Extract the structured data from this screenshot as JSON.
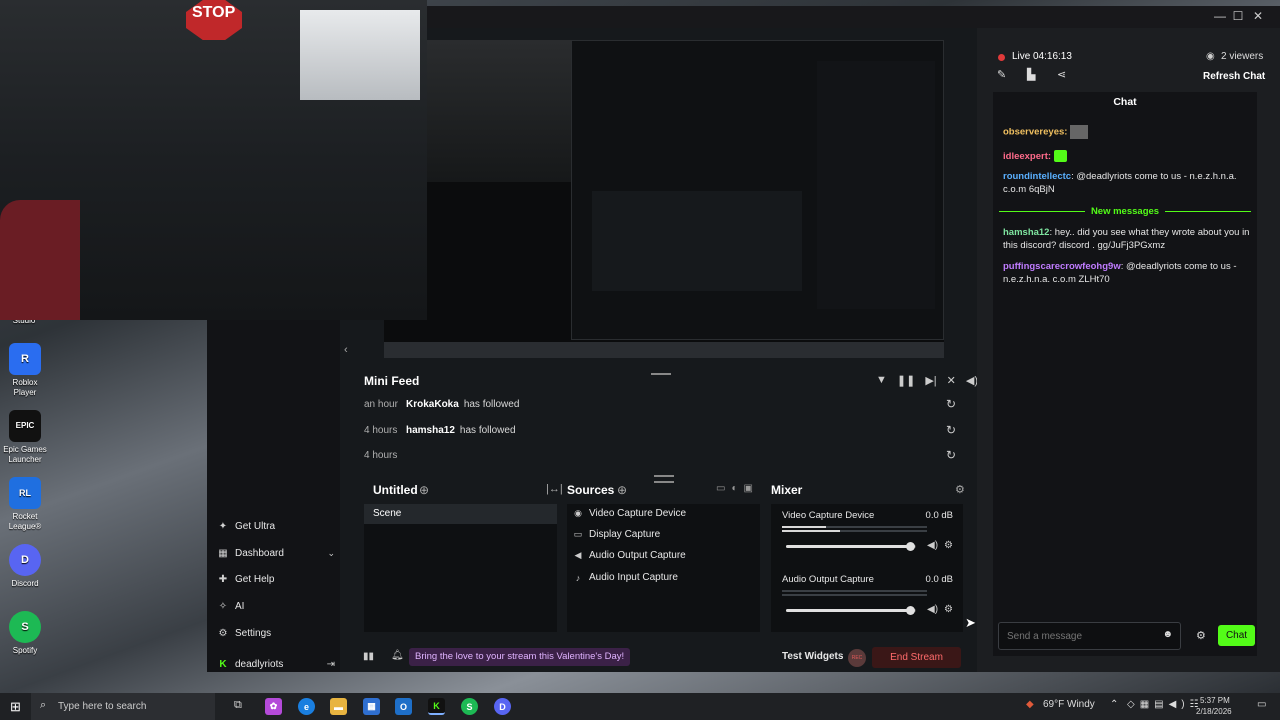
{
  "desktop": {
    "icons": [
      {
        "label": "Studio",
        "color": "#3a3f45",
        "glyph": ""
      },
      {
        "label": "Roblox Player",
        "color": "#2a6df0",
        "glyph": "R"
      },
      {
        "label": "Epic Games Launcher",
        "color": "#111111",
        "glyph": "EPIC"
      },
      {
        "label": "Rocket League®",
        "color": "#1f6fe0",
        "glyph": "RL"
      },
      {
        "label": "Discord",
        "color": "#5865f2",
        "glyph": "D"
      },
      {
        "label": "Spotify",
        "color": "#1db954",
        "glyph": "S"
      }
    ]
  },
  "webcam": {
    "sign": "STOP"
  },
  "app": {
    "window_controls": [
      "—",
      "☐",
      "✕"
    ],
    "nav": {
      "items": [
        {
          "label": "Get Ultra",
          "icon": "sparkle-icon"
        },
        {
          "label": "Dashboard",
          "icon": "dashboard-icon",
          "has_chevron": true
        },
        {
          "label": "Get Help",
          "icon": "help-icon"
        },
        {
          "label": "AI",
          "icon": "ai-icon"
        },
        {
          "label": "Settings",
          "icon": "gear-icon"
        }
      ],
      "user": "deadlyriots"
    },
    "mini_feed": {
      "title": "Mini Feed",
      "rows": [
        {
          "time": "an hour",
          "name": "KrokaKoka",
          "action": "has followed"
        },
        {
          "time": "4 hours",
          "name": "hamsha12",
          "action": "has followed"
        },
        {
          "time": "4 hours",
          "name": "",
          "action": ""
        }
      ]
    },
    "scenes": {
      "title": "Untitled",
      "items": [
        "Scene"
      ]
    },
    "sources": {
      "title": "Sources",
      "items": [
        {
          "label": "Video Capture Device",
          "icon": "webcam-icon"
        },
        {
          "label": "Display Capture",
          "icon": "monitor-icon"
        },
        {
          "label": "Audio Output Capture",
          "icon": "speaker-icon"
        },
        {
          "label": "Audio Input Capture",
          "icon": "mic-icon"
        }
      ]
    },
    "mixer": {
      "title": "Mixer",
      "channels": [
        {
          "name": "Video Capture Device",
          "db": "0.0 dB",
          "level": 0.95
        },
        {
          "name": "Audio Output Capture",
          "db": "0.0 dB",
          "level": 0.95
        }
      ]
    },
    "footer": {
      "promo": "Bring the love to your stream this Valentine's Day!",
      "test_widgets": "Test Widgets",
      "rec_label": "REC",
      "end_stream": "End Stream"
    },
    "stream": {
      "live_label": "Live",
      "duration": "04:16:13",
      "viewers": "2 viewers",
      "refresh": "Refresh Chat"
    },
    "chat": {
      "title": "Chat",
      "messages": [
        {
          "user": "observereyes:",
          "text": "",
          "color": "#f0c060",
          "emote": true
        },
        {
          "user": "idleexpert:",
          "text": "",
          "color": "#ff6b8b",
          "emote": true
        },
        {
          "user": "roundintellectc",
          "text": ": @deadlyriots come to us - n.e.z.h.n.a. c.o.m 6qBjN",
          "color": "#5ab0ff"
        },
        {
          "user": "hamsha12",
          "text": ": hey.. did you see what they wrote about you in this discord? discord . gg/JuFj3PGxmz",
          "color": "#7fe5a0"
        },
        {
          "user": "puffingscarecrowfeohg9w",
          "text": ": @deadlyriots come to us - n.e.z.h.n.a. c.o.m ZLHt70",
          "color": "#c07cff"
        }
      ],
      "divider": "New messages",
      "placeholder": "Send a message",
      "send_label": "Chat"
    }
  },
  "taskbar": {
    "search_placeholder": "Type here to search",
    "weather": "69°F  Windy",
    "time": "5:37 PM",
    "date": "2/18/2026"
  }
}
